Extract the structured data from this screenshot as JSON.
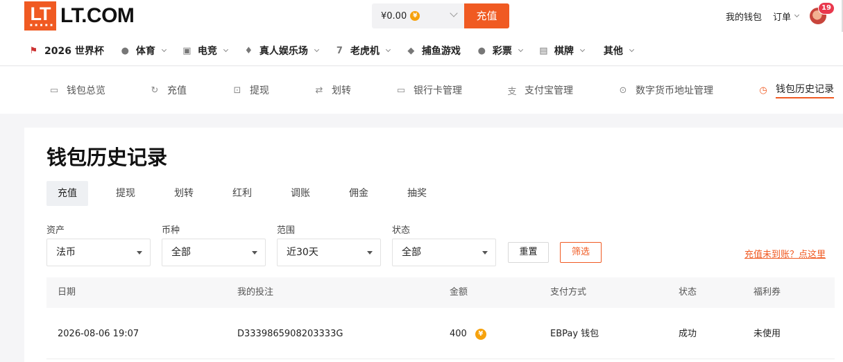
{
  "brand": {
    "mark": "LT",
    "name": "LT.COM",
    "color": "#f05a22"
  },
  "wallet": {
    "balance": "¥0.00",
    "deposit_label": "充值"
  },
  "top_right": {
    "my_wallet": "我的钱包",
    "orders": "订单",
    "badge_count": "19"
  },
  "main_nav": [
    {
      "label": "2026 世界杯",
      "icon": "worldcup-icon",
      "has_dropdown": false
    },
    {
      "label": "体育",
      "icon": "ball-icon",
      "has_dropdown": true
    },
    {
      "label": "电竞",
      "icon": "gamepad-icon",
      "has_dropdown": true
    },
    {
      "label": "真人娱乐场",
      "icon": "diamond-icon",
      "has_dropdown": true
    },
    {
      "label": "老虎机",
      "icon": "slot-icon",
      "has_dropdown": true
    },
    {
      "label": "捕鱼游戏",
      "icon": "fish-icon",
      "has_dropdown": false
    },
    {
      "label": "彩票",
      "icon": "lottery-icon",
      "has_dropdown": true
    },
    {
      "label": "棋牌",
      "icon": "cards-icon",
      "has_dropdown": true
    },
    {
      "label": "其他",
      "icon": "",
      "has_dropdown": true
    }
  ],
  "sub_nav": [
    {
      "label": "钱包总览",
      "icon": "wallet-icon",
      "active": false
    },
    {
      "label": "充值",
      "icon": "deposit-icon",
      "active": false
    },
    {
      "label": "提现",
      "icon": "withdraw-icon",
      "active": false
    },
    {
      "label": "划转",
      "icon": "transfer-icon",
      "active": false
    },
    {
      "label": "银行卡管理",
      "icon": "bank-card-icon",
      "active": false
    },
    {
      "label": "支付宝管理",
      "icon": "alipay-icon",
      "active": false
    },
    {
      "label": "数字货币地址管理",
      "icon": "crypto-address-icon",
      "active": false
    },
    {
      "label": "钱包历史记录",
      "icon": "history-clock-icon",
      "active": true
    }
  ],
  "page": {
    "title": "钱包历史记录"
  },
  "tabs": [
    {
      "label": "充值",
      "active": true
    },
    {
      "label": "提现",
      "active": false
    },
    {
      "label": "划转",
      "active": false
    },
    {
      "label": "红利",
      "active": false
    },
    {
      "label": "调账",
      "active": false
    },
    {
      "label": "佣金",
      "active": false
    },
    {
      "label": "抽奖",
      "active": false
    }
  ],
  "filters": [
    {
      "label": "资产",
      "value": "法币"
    },
    {
      "label": "币种",
      "value": "全部"
    },
    {
      "label": "范围",
      "value": "近30天"
    },
    {
      "label": "状态",
      "value": "全部"
    }
  ],
  "actions": {
    "reset": "重置",
    "filter": "筛选",
    "help": "充值未到账？点这里"
  },
  "table": {
    "headers": [
      "日期",
      "我的投注",
      "金额",
      "支付方式",
      "状态",
      "福利券"
    ],
    "rows": [
      {
        "date": "2026-08-06 19:07",
        "order": "D3339865908203333G",
        "amount": "400",
        "method": "EBPay 钱包",
        "status": "成功",
        "coupon": "未使用"
      }
    ]
  }
}
